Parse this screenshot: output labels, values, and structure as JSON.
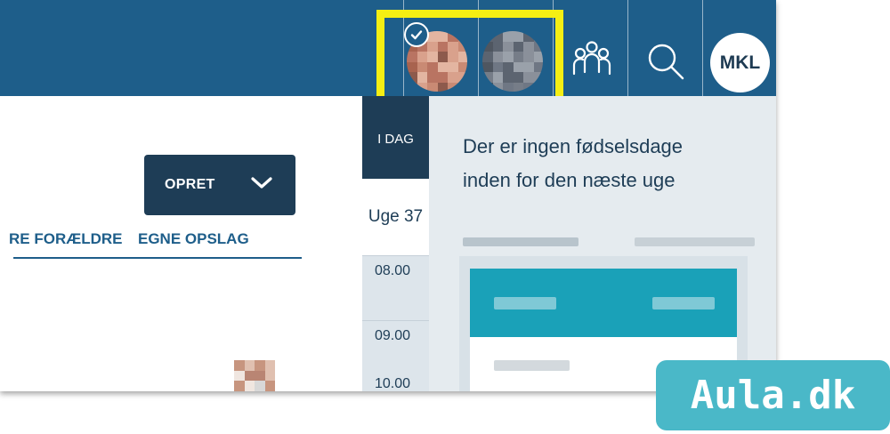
{
  "header": {
    "user_initials": "MKL",
    "icons": {
      "group": "people-group-icon",
      "search": "search-icon",
      "check": "check-icon"
    }
  },
  "left_panel": {
    "create_button_label": "OPRET",
    "tabs": [
      "RE FORÆLDRE",
      "EGNE OPSLAG"
    ]
  },
  "calendar": {
    "today_tab": "I DAG",
    "week_label": "Uge 37",
    "times": [
      "08.00",
      "09.00",
      "10.00"
    ]
  },
  "birthdays": {
    "message_lines": [
      "Der er ingen fødselsdage",
      "inden for den næste uge"
    ]
  },
  "branding": {
    "watermark": "Aula.dk"
  },
  "colors": {
    "topbar": "#1e5e8a",
    "dark_navy": "#1e3d56",
    "highlight": "#f5ef13",
    "event_accent": "#1aa1b8",
    "brand": "#4ab8c8"
  }
}
